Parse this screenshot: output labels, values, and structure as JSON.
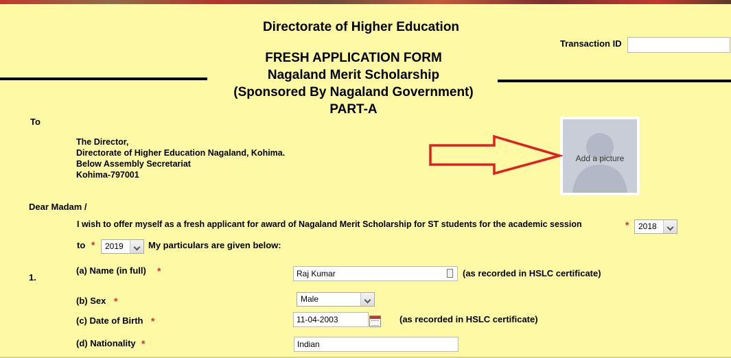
{
  "header": {
    "directorate": "Directorate of Higher Education",
    "form_title": "FRESH APPLICATION FORM",
    "scheme": "Nagaland Merit Scholarship",
    "sponsor": "(Sponsored By Nagaland Government)",
    "part": "PART-A",
    "transaction_label": "Transaction ID",
    "transaction_value": ""
  },
  "letter": {
    "to": "To",
    "address_lines": [
      "The Director,",
      "Directorate of Higher Education Nagaland, Kohima.",
      "Below Assembly Secretariat",
      "Kohima-797001"
    ],
    "salutation": "Dear Madam /",
    "intro": "I wish to offer myself as a fresh applicant for award of Nagaland Merit Scholarship for ST students for the academic session",
    "session_from": "2018",
    "to_word": "to",
    "session_to": "2019",
    "particulars": "My particulars are given below:"
  },
  "photo": {
    "label": "Add a picture"
  },
  "fields": {
    "section_number": "1.",
    "name_label": "(a) Name (in full)",
    "name_value": "Raj Kumar",
    "name_note": "(as recorded in HSLC certificate)",
    "sex_label": "(b) Sex",
    "sex_value": "Male",
    "dob_label": "(c) Date of Birth",
    "dob_value": "11-04-2003",
    "dob_note": "(as recorded in HSLC certificate)",
    "nationality_label": "(d) Nationality",
    "nationality_value": "Indian"
  },
  "required_marker": "*",
  "colors": {
    "background": "#fdf9a5",
    "required": "#d32f2f",
    "arrow": "#e02020"
  }
}
